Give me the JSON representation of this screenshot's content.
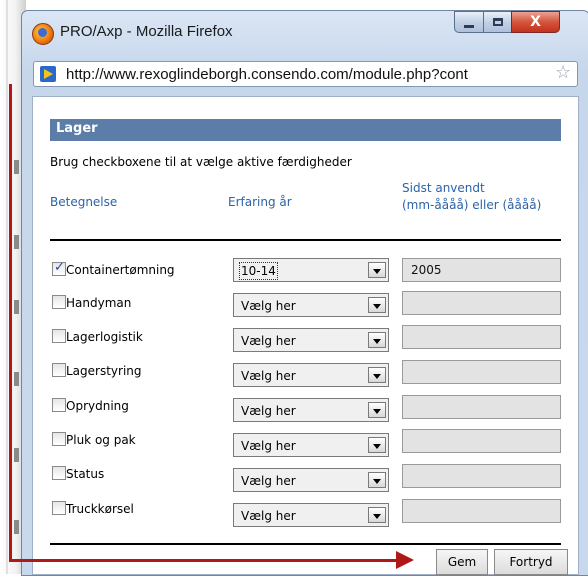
{
  "window": {
    "title": "PRO/Axp - Mozilla Firefox"
  },
  "browser": {
    "url": "http://www.rexoglindeborgh.consendo.com/module.php?cont"
  },
  "panel": {
    "title": "Lager",
    "instruction": "Brug checkboxene til at vælge aktive færdigheder",
    "columns": {
      "name": "Betegnelse",
      "experience": "Erfaring år",
      "last_used_line1": "Sidst anvendt",
      "last_used_line2": "(mm-åååå) eller (åååå)"
    },
    "rows": [
      {
        "label": "Containertømning",
        "checked": true,
        "experience": "10-14",
        "last_used": "2005"
      },
      {
        "label": "Handyman",
        "checked": false,
        "experience": "Vælg her",
        "last_used": ""
      },
      {
        "label": "Lagerlogistik",
        "checked": false,
        "experience": "Vælg her",
        "last_used": ""
      },
      {
        "label": "Lagerstyring",
        "checked": false,
        "experience": "Vælg her",
        "last_used": ""
      },
      {
        "label": "Oprydning",
        "checked": false,
        "experience": "Vælg her",
        "last_used": ""
      },
      {
        "label": "Pluk og pak",
        "checked": false,
        "experience": "Vælg her",
        "last_used": ""
      },
      {
        "label": "Status",
        "checked": false,
        "experience": "Vælg her",
        "last_used": ""
      },
      {
        "label": "Truckkørsel",
        "checked": false,
        "experience": "Vælg her",
        "last_used": ""
      }
    ]
  },
  "buttons": {
    "save": "Gem",
    "cancel": "Fortryd"
  },
  "window_controls": {
    "close_glyph": "X"
  },
  "accent_colors": {
    "annotation_arrow": "#b01818",
    "panel_header": "#5c7da7",
    "column_header": "#2b63a8"
  }
}
